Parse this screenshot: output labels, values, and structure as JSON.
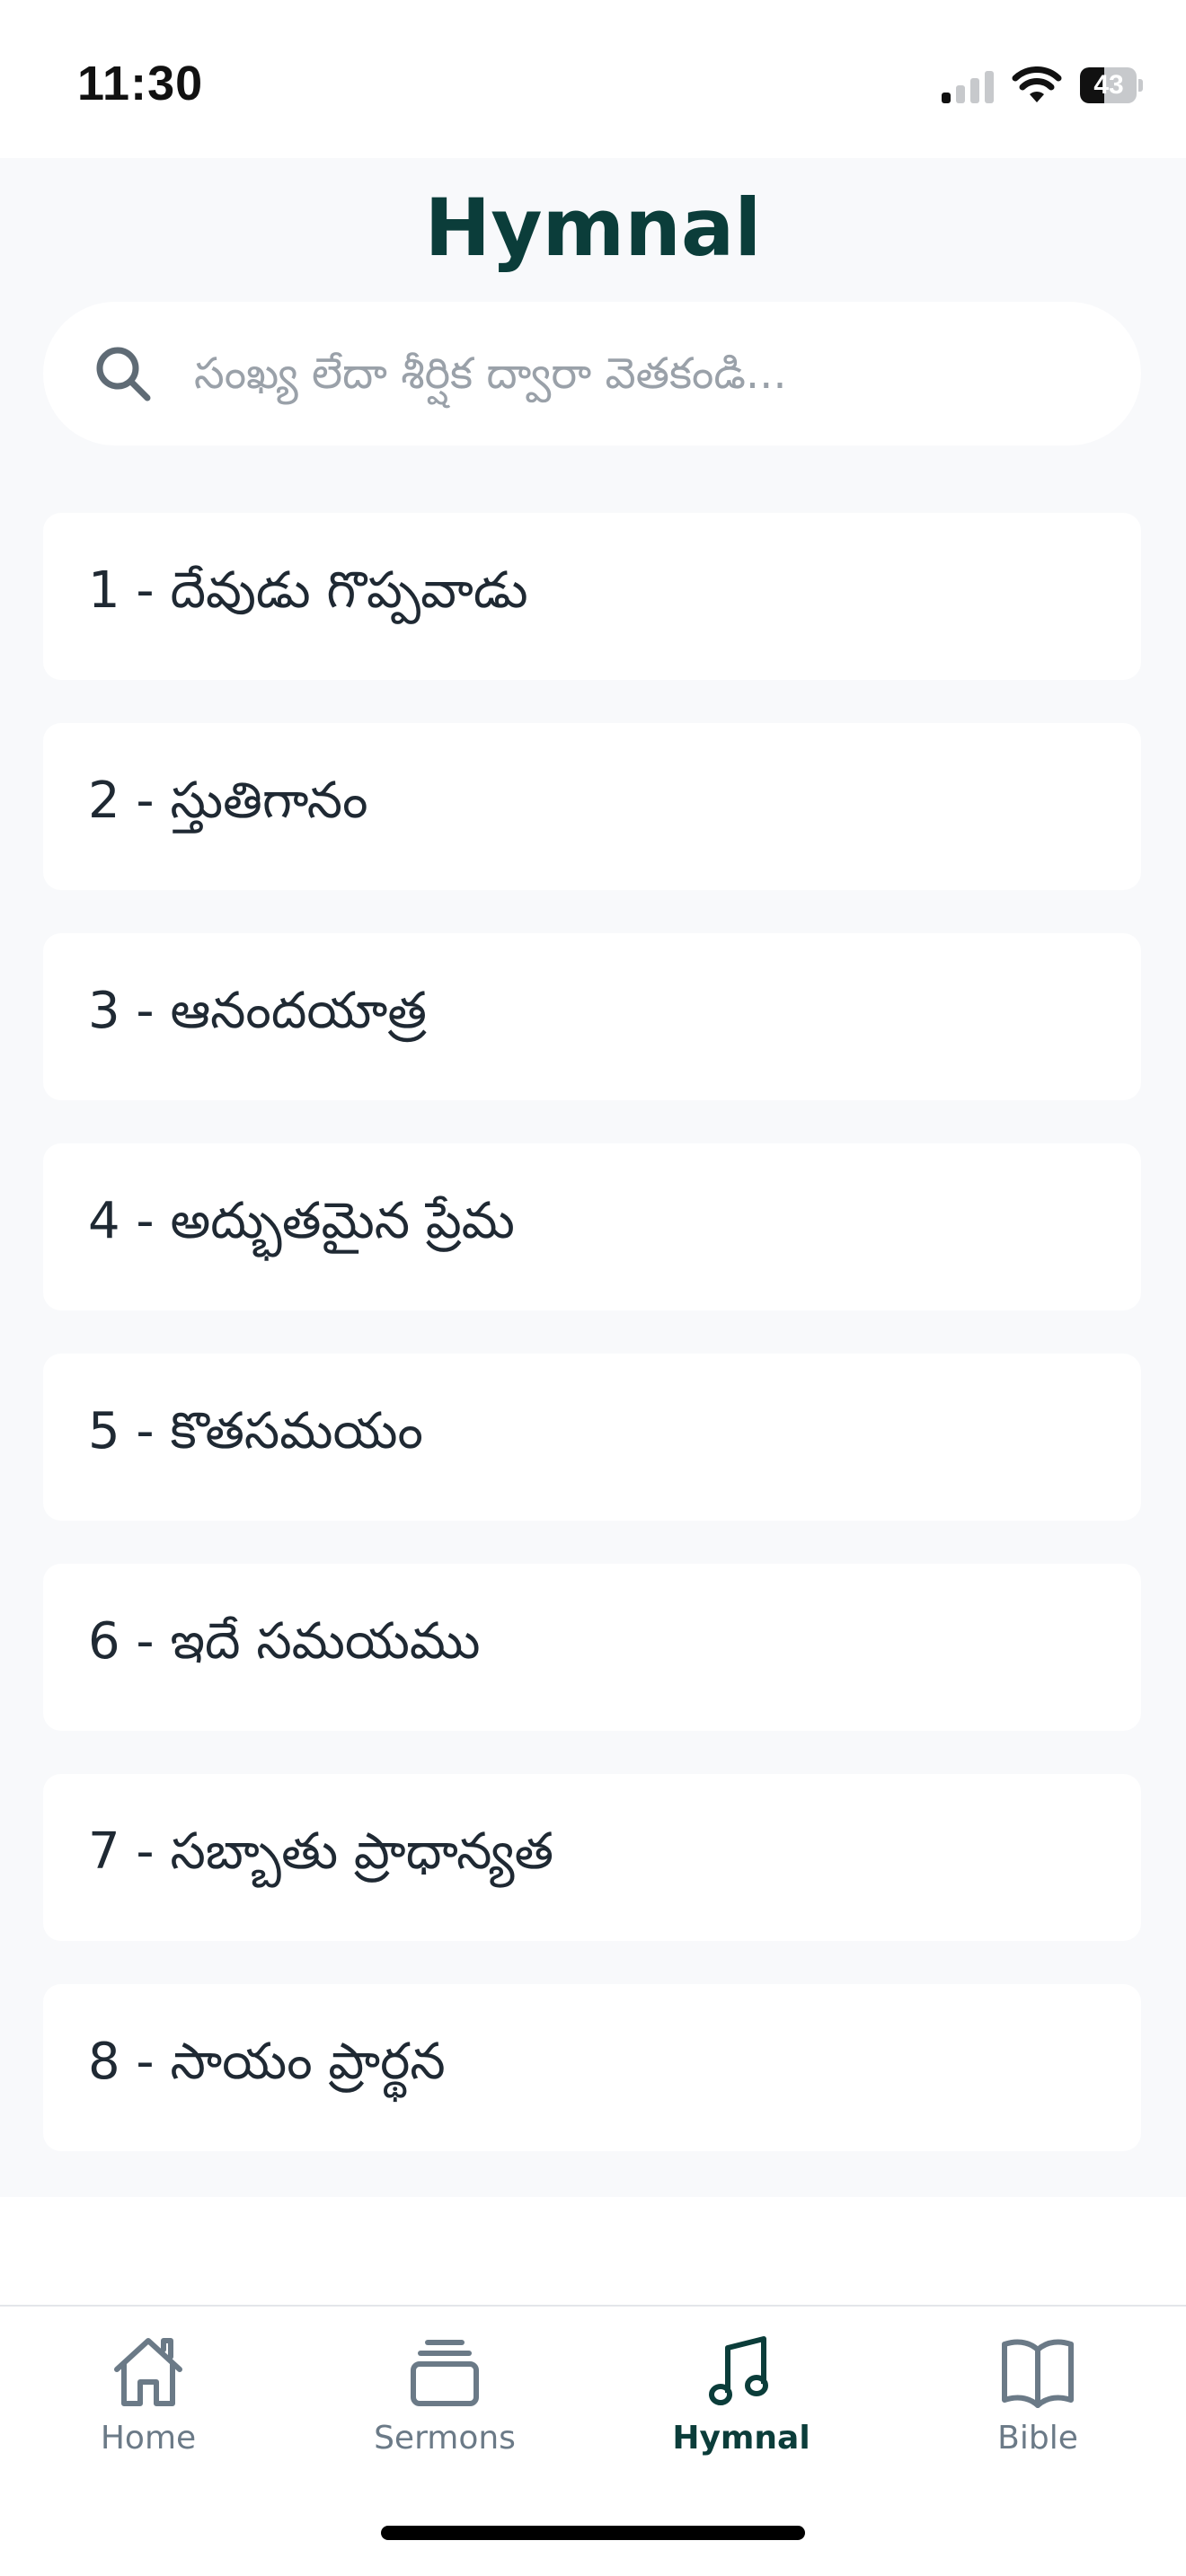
{
  "status_bar": {
    "time": "11:30",
    "battery": "43",
    "battery_level": 0.43,
    "icons": [
      "cellular-signal-icon",
      "wifi-icon",
      "battery-icon"
    ]
  },
  "header": {
    "title": "Hymnal"
  },
  "search": {
    "placeholder": "సంఖ్య లేదా శీర్షిక ద్వారా వెతకండి...",
    "value": "",
    "icon": "search-icon"
  },
  "hymns": [
    {
      "label": "1 - దేవుడు గొప్పవాడు"
    },
    {
      "label": "2 - స్తుతిగానం"
    },
    {
      "label": "3 - ఆనందయాత్ర"
    },
    {
      "label": "4 - అద్భుతమైన ప్రేమ"
    },
    {
      "label": "5 - కొతసమయం"
    },
    {
      "label": "6 - ఇదే సమయము"
    },
    {
      "label": "7 - సబ్బాతు ప్రాధాన్యత"
    },
    {
      "label": "8 - సాయం ప్రార్థన"
    }
  ],
  "tab_bar": {
    "active": "Hymnal",
    "items": [
      {
        "label": "Home",
        "icon": "home-icon"
      },
      {
        "label": "Sermons",
        "icon": "sermons-icon"
      },
      {
        "label": "Hymnal",
        "icon": "music-note-icon"
      },
      {
        "label": "Bible",
        "icon": "book-icon"
      }
    ]
  },
  "colors": {
    "accent": "#0b3d3a",
    "inactive": "#6b7a87",
    "background": "#f8f9fb",
    "card": "#ffffff"
  }
}
